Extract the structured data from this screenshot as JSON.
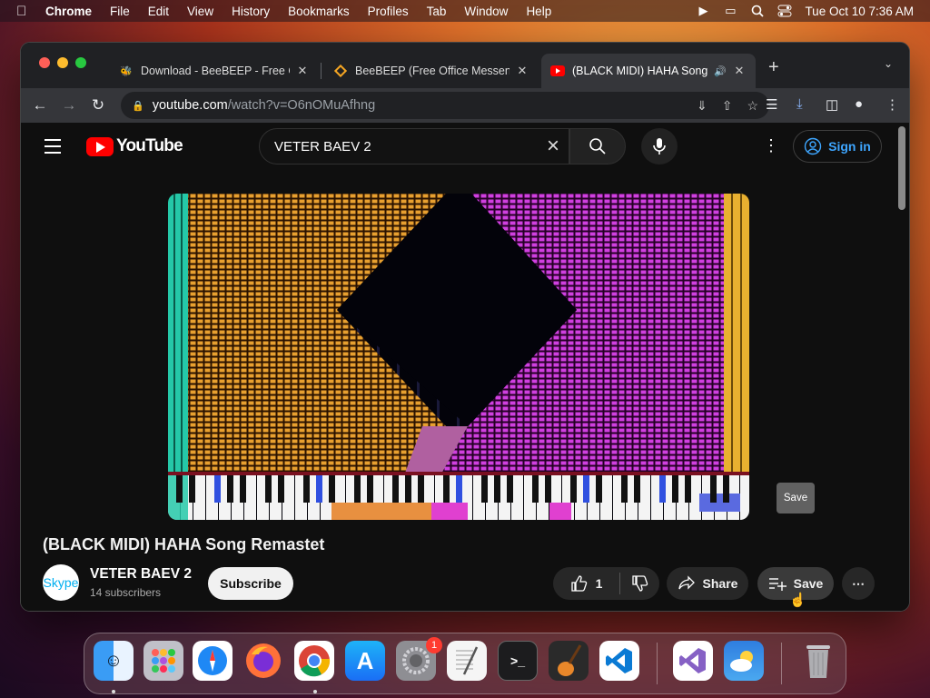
{
  "menubar": {
    "app": "Chrome",
    "items": [
      "File",
      "Edit",
      "View",
      "History",
      "Bookmarks",
      "Profiles",
      "Tab",
      "Window",
      "Help"
    ],
    "clock": "Tue Oct 10  7:36 AM"
  },
  "tabs": [
    {
      "title": "Download - BeeBEEP - Free O",
      "icon": "beebeep-bee-icon"
    },
    {
      "title": "BeeBEEP (Free Office Messen",
      "icon": "beebeep-diamond-icon"
    },
    {
      "title": "(BLACK MIDI) HAHA Song",
      "icon": "youtube-icon",
      "active": true
    }
  ],
  "address": {
    "host": "youtube.com",
    "path": "/watch?v=O6nOMuAfhng"
  },
  "youtube": {
    "logo_text": "YouTube",
    "search_value": "VETER BAEV 2",
    "signin_label": "Sign in",
    "tooltip": "Save",
    "video_title": "(BLACK MIDI) HAHA Song Remastet",
    "channel": {
      "name": "VETER BAEV 2",
      "subscribers": "14 subscribers",
      "avatar_text": "Skype"
    },
    "subscribe_label": "Subscribe",
    "like_count": "1",
    "share_label": "Share",
    "save_label": "Save"
  },
  "dock": {
    "settings_badge": "1"
  },
  "colors": {
    "youtube_red": "#ff0000",
    "signin_blue": "#3ea6ff",
    "orange_notes": "#e8a030",
    "magenta_notes": "#d040e0"
  }
}
